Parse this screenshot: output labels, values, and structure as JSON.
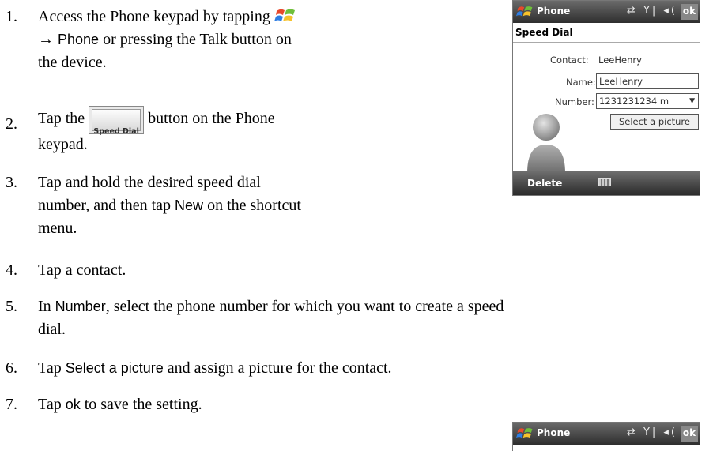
{
  "steps": [
    {
      "num": "1.",
      "line1": "Access the Phone keypad by tapping ",
      "line2_ui": "Phone",
      "line2_text": " or pressing the Talk button on",
      "line3": "the device."
    },
    {
      "num": "2.",
      "pre": "Tap the ",
      "button_label": "Speed Dial",
      "post": " button on the Phone",
      "line2": "keypad."
    },
    {
      "num": "3.",
      "line1": "Tap and hold the desired speed dial",
      "line2_pre": "number, and then tap ",
      "line2_ui": "New",
      "line2_post": " on the shortcut",
      "line3": "menu."
    },
    {
      "num": "4.",
      "line1": "Tap a contact."
    },
    {
      "num": "5.",
      "line1_pre": "In ",
      "line1_ui": "Number",
      "line1_post": ", select the phone number for which you want to create a speed",
      "line2": "dial."
    },
    {
      "num": "6.",
      "pre": "Tap ",
      "ui": "Select a picture",
      "post": " and assign a picture for the contact."
    },
    {
      "num": "7.",
      "pre": "Tap ",
      "ui": "ok",
      "post": " to save the setting."
    }
  ],
  "screen": {
    "title": "Phone",
    "status_icons": "⇄ Y| ◂(",
    "ok": "ok",
    "header": "Speed Dial",
    "contact_label": "Contact:",
    "contact_value": "LeeHenry",
    "name_label": "Name:",
    "name_value": "LeeHenry",
    "number_label": "Number:",
    "number_value": "1231231234 m",
    "select_picture": "Select a picture",
    "softkey_left": "Delete"
  },
  "screen2": {
    "title": "Phone",
    "status_icons": "⇄ Y| ◂(",
    "ok": "ok"
  }
}
